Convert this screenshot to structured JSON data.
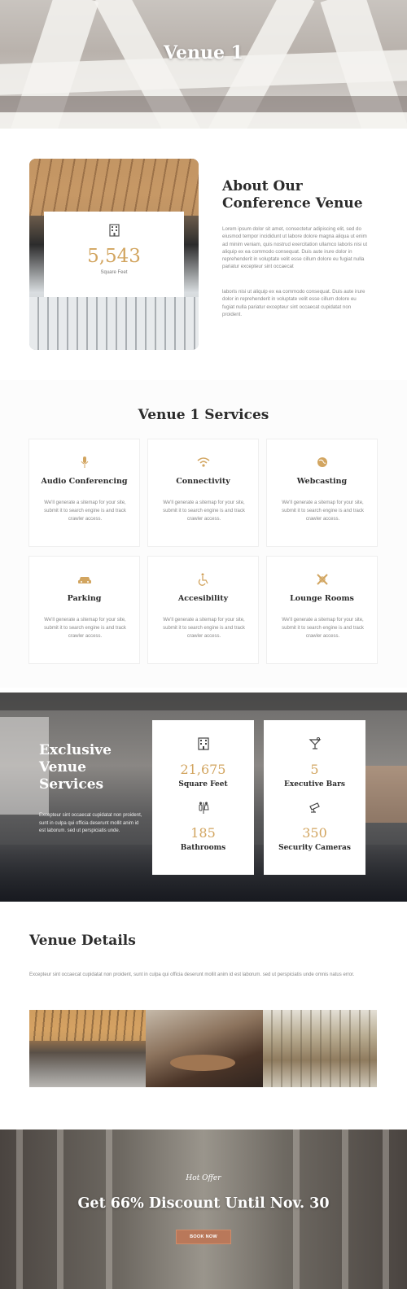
{
  "hero": {
    "title": "Venue 1"
  },
  "about": {
    "title_line1": "About Our",
    "title_line2": "Conference Venue",
    "stat_value": "5,543",
    "stat_label": "Square Feet",
    "paragraph1": "Lorem ipsum dolor sit amet, consectetur adipiscing elit, sed do eiusmod tempor incididunt ut labore dolore magna aliqua ut enim ad minim veniam, quis nostrud exercitation ullamco laboris nisi ut aliquip ex ea commodo consequat. Duis aute irure dolor in reprehenderit in voluptate velit esse cillum dolore eu fugiat nulla pariatur excepteur sint occaecat",
    "paragraph2": "laboris nisi ut aliquip ex ea commodo consequat. Duis aute irure dolor in reprehenderit in voluptate velit esse cillum dolore eu fugiat nulla pariatur excepteur sint occaecat cupidatat non proident."
  },
  "services": {
    "title": "Venue 1 Services",
    "items": [
      {
        "name": "Audio Conferencing",
        "icon": "microphone-icon",
        "desc": "We'll generate a sitemap for your site, submit it to search engine is and track crawler access."
      },
      {
        "name": "Connectivity",
        "icon": "wifi-icon",
        "desc": "We'll generate a sitemap for your site, submit it to search engine is and track crawler access."
      },
      {
        "name": "Webcasting",
        "icon": "globe-icon",
        "desc": "We'll generate a sitemap for your site, submit it to search engine is and track crawler access."
      },
      {
        "name": "Parking",
        "icon": "car-icon",
        "desc": "We'll generate a sitemap for your site, submit it to search engine is and track crawler access."
      },
      {
        "name": "Accesibility",
        "icon": "wheelchair-icon",
        "desc": "We'll generate a sitemap for your site, submit it to search engine is and track crawler access."
      },
      {
        "name": "Lounge Rooms",
        "icon": "lounge-icon",
        "desc": "We'll generate a sitemap for your site, submit it to search engine is and track crawler access."
      }
    ]
  },
  "exclusive": {
    "title_line1": "Exclusive",
    "title_line2": "Venue",
    "title_line3": "Services",
    "paragraph": "Excepteur sint occaecat cupidatat non proident, sunt in culpa qui officia deserunt mollit anim id est laborum. sed ut perspiciatis unde.",
    "stats": [
      {
        "value": "21,675",
        "label": "Square Feet",
        "icon": "building-icon"
      },
      {
        "value": "185",
        "label": "Bathrooms",
        "icon": "restroom-icon"
      },
      {
        "value": "5",
        "label": "Executive Bars",
        "icon": "cocktail-icon"
      },
      {
        "value": "350",
        "label": "Security Cameras",
        "icon": "camera-icon"
      }
    ]
  },
  "details": {
    "title": "Venue Details",
    "paragraph": "Excepteur sint occaecat cupidatat non proident, sunt in culpa qui officia deserunt mollit anim id est laborum. sed ut perspiciatis unde omnis natus error."
  },
  "offer": {
    "kicker": "Hot Offer",
    "title": "Get 66% Discount Until Nov. 30",
    "button": "BOOK NOW"
  },
  "colors": {
    "accent": "#d2a560",
    "button": "#b9785a",
    "heading": "#2b2b2b",
    "body": "#888888"
  }
}
